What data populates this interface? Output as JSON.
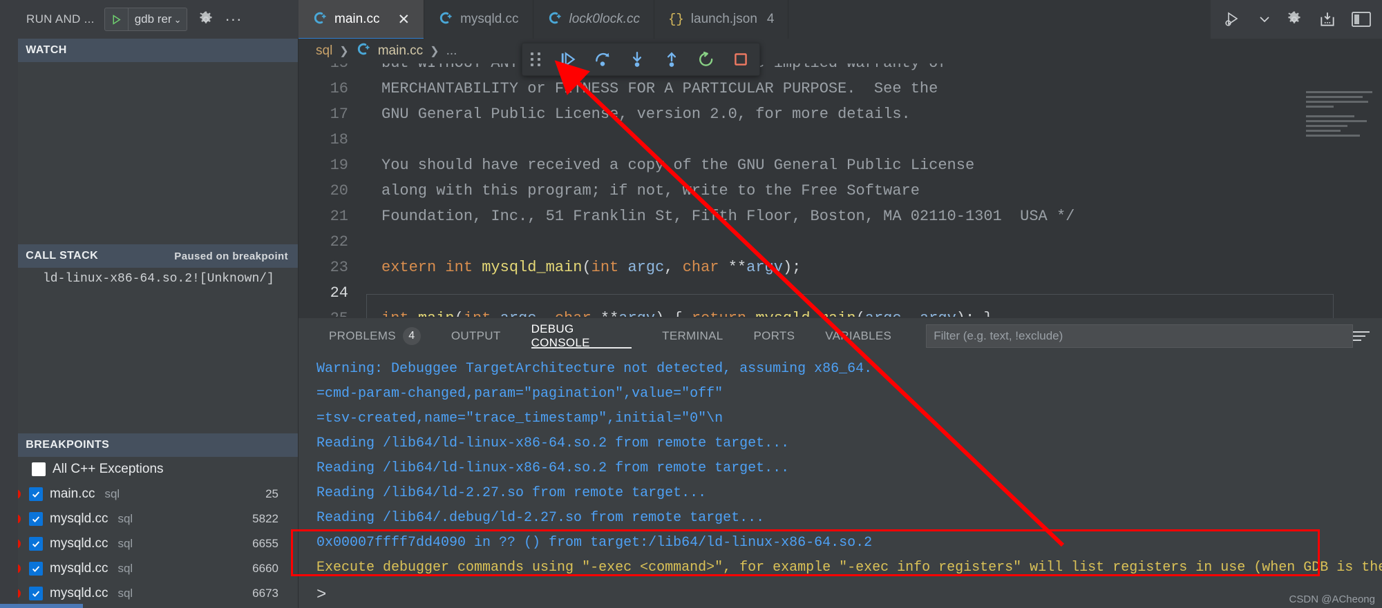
{
  "window": {
    "run_and_debug_title": "RUN AND ...",
    "launch_config": "gdb rer",
    "right_icons": [
      "run-debug-icon",
      "chevron-down-icon",
      "gear-icon",
      "install-extension-icon",
      "layout-panel-icon"
    ]
  },
  "tabs": [
    {
      "label": "main.cc",
      "icon": "cpp-file-icon",
      "active": true,
      "preview": false,
      "closable": true,
      "badge": ""
    },
    {
      "label": "mysqld.cc",
      "icon": "cpp-file-icon",
      "active": false,
      "preview": false,
      "closable": false,
      "badge": ""
    },
    {
      "label": "lock0lock.cc",
      "icon": "cpp-file-icon",
      "active": false,
      "preview": true,
      "closable": false,
      "badge": ""
    },
    {
      "label": "launch.json",
      "icon": "json-file-icon",
      "active": false,
      "preview": false,
      "closable": false,
      "badge": "4"
    }
  ],
  "debug_toolbar": {
    "buttons": [
      {
        "name": "drag-handle",
        "label": "Drag"
      },
      {
        "name": "continue-button",
        "label": "Continue"
      },
      {
        "name": "step-over-button",
        "label": "Step Over"
      },
      {
        "name": "step-into-button",
        "label": "Step Into"
      },
      {
        "name": "step-out-button",
        "label": "Step Out"
      },
      {
        "name": "restart-button",
        "label": "Restart"
      },
      {
        "name": "stop-button",
        "label": "Stop"
      }
    ],
    "colors": {
      "primary": "#75b6f0",
      "restart": "#89d185",
      "stop": "#f07a63"
    }
  },
  "sidebar": {
    "watch": {
      "title": "WATCH",
      "items": []
    },
    "callstack": {
      "title": "CALL STACK",
      "status": "Paused on breakpoint",
      "items": [
        "ld-linux-x86-64.so.2![Unknown/]"
      ]
    },
    "breakpoints": {
      "title": "BREAKPOINTS",
      "items": [
        {
          "label": "All C++ Exceptions",
          "scope": "",
          "line": "",
          "checked": false,
          "has_dot": false
        },
        {
          "label": "main.cc",
          "scope": "sql",
          "line": "25",
          "checked": true,
          "has_dot": true
        },
        {
          "label": "mysqld.cc",
          "scope": "sql",
          "line": "5822",
          "checked": true,
          "has_dot": true
        },
        {
          "label": "mysqld.cc",
          "scope": "sql",
          "line": "6655",
          "checked": true,
          "has_dot": true
        },
        {
          "label": "mysqld.cc",
          "scope": "sql",
          "line": "6660",
          "checked": true,
          "has_dot": true
        },
        {
          "label": "mysqld.cc",
          "scope": "sql",
          "line": "6673",
          "checked": true,
          "has_dot": true
        }
      ]
    }
  },
  "editor": {
    "breadcrumb": {
      "root": "sql",
      "file": "main.cc",
      "tail": "..."
    },
    "lines": [
      {
        "num": "15",
        "text": "but WITHOUT ANY WARRANTY; without even the implied warranty of",
        "type": "comment",
        "partial": true
      },
      {
        "num": "16",
        "text": "MERCHANTABILITY or FITNESS FOR A PARTICULAR PURPOSE.  See the",
        "type": "comment"
      },
      {
        "num": "17",
        "text": "GNU General Public License, version 2.0, for more details.",
        "type": "comment"
      },
      {
        "num": "18",
        "text": "",
        "type": "comment"
      },
      {
        "num": "19",
        "text": "You should have received a copy of the GNU General Public License",
        "type": "comment"
      },
      {
        "num": "20",
        "text": "along with this program; if not, write to the Free Software",
        "type": "comment"
      },
      {
        "num": "21",
        "text": "Foundation, Inc., 51 Franklin St, Fifth Floor, Boston, MA 02110-1301  USA */",
        "type": "comment"
      },
      {
        "num": "22",
        "text": "",
        "type": "comment"
      },
      {
        "num": "23",
        "text": "extern int mysqld_main(int argc, char **argv);",
        "type": "code"
      },
      {
        "num": "24",
        "text": "",
        "type": "code",
        "active": true
      },
      {
        "num": "25",
        "text": "int main(int argc, char **argv) { return mysqld_main(argc, argv); }",
        "type": "code",
        "partial": true
      }
    ]
  },
  "panel": {
    "tabs": [
      {
        "label": "PROBLEMS",
        "badge": "4",
        "active": false
      },
      {
        "label": "OUTPUT",
        "badge": "",
        "active": false
      },
      {
        "label": "DEBUG CONSOLE",
        "badge": "",
        "active": true
      },
      {
        "label": "TERMINAL",
        "badge": "",
        "active": false
      },
      {
        "label": "PORTS",
        "badge": "",
        "active": false
      },
      {
        "label": "VARIABLES",
        "badge": "",
        "active": false
      }
    ],
    "filter": {
      "value": "",
      "placeholder": "Filter (e.g. text, !exclude)"
    },
    "console_lines": [
      {
        "text": "Warning: Debuggee TargetArchitecture not detected, assuming x86_64.",
        "color": "blue"
      },
      {
        "text": "=cmd-param-changed,param=\"pagination\",value=\"off\"",
        "color": "blue"
      },
      {
        "text": "=tsv-created,name=\"trace_timestamp\",initial=\"0\"\\n",
        "color": "blue"
      },
      {
        "text": "Reading /lib64/ld-linux-x86-64.so.2 from remote target...",
        "color": "blue"
      },
      {
        "text": "Reading /lib64/ld-linux-x86-64.so.2 from remote target...",
        "color": "blue"
      },
      {
        "text": "Reading /lib64/ld-2.27.so from remote target...",
        "color": "blue"
      },
      {
        "text": "Reading /lib64/.debug/ld-2.27.so from remote target...",
        "color": "blue"
      },
      {
        "text": "0x00007ffff7dd4090 in ?? () from target:/lib64/ld-linux-x86-64.so.2",
        "color": "blue"
      },
      {
        "text": "Execute debugger commands using \"-exec <command>\", for example \"-exec info registers\" will list registers in use (when GDB is the debugger)",
        "color": "yellow"
      }
    ],
    "prompt": ">"
  },
  "watermark": "CSDN @ACheong"
}
